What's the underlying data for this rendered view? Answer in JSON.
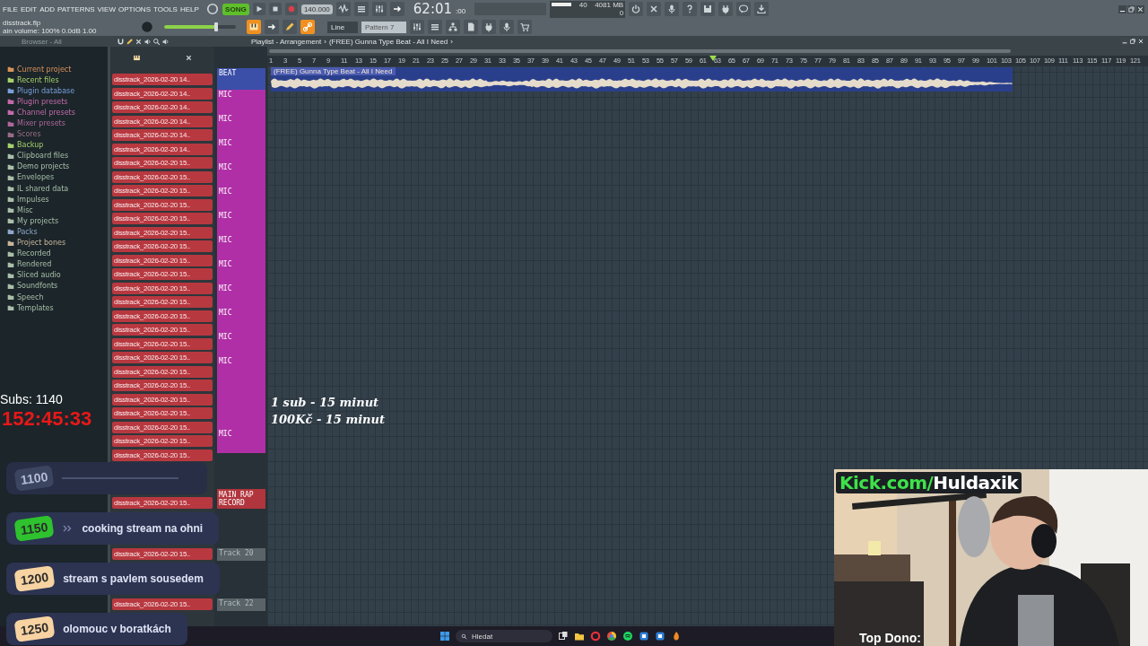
{
  "menu": [
    "FILE",
    "EDIT",
    "ADD",
    "PATTERNS",
    "VIEW",
    "OPTIONS",
    "TOOLS",
    "HELP"
  ],
  "transport": {
    "song_mode": {
      "label": "SONG",
      "on": true
    },
    "tempo": "140.000",
    "time": "62:01",
    "time_sub": ":00",
    "cpu": "40",
    "memory": "4081 MB",
    "polyphony": "0"
  },
  "project": {
    "file": "disstrack.flp",
    "hint": "ain volume: 100% 0.0dB 1.00",
    "master_volume": {
      "level": 0.72
    },
    "snap": "Line",
    "pattern": "Pattern 7"
  },
  "browser": {
    "title": "Browser - All",
    "items": [
      {
        "label": "Current project",
        "color": "#d9925a"
      },
      {
        "label": "Recent files",
        "color": "#a6d06a"
      },
      {
        "label": "Plugin database",
        "color": "#7a9fd8"
      },
      {
        "label": "Plugin presets",
        "color": "#c26aa8"
      },
      {
        "label": "Channel presets",
        "color": "#c26aa8"
      },
      {
        "label": "Mixer presets",
        "color": "#b0669a"
      },
      {
        "label": "Scores",
        "color": "#9a6c88"
      },
      {
        "label": "Backup",
        "color": "#a6d06a"
      },
      {
        "label": "Clipboard files",
        "color": "#a9bfa8"
      },
      {
        "label": "Demo projects",
        "color": "#a9bfa8"
      },
      {
        "label": "Envelopes",
        "color": "#a9bfa8"
      },
      {
        "label": "IL shared data",
        "color": "#a9bfa8"
      },
      {
        "label": "Impulses",
        "color": "#a9bfa8"
      },
      {
        "label": "Misc",
        "color": "#a9bfa8"
      },
      {
        "label": "My projects",
        "color": "#a9bfa8"
      },
      {
        "label": "Packs",
        "color": "#8fa6c8"
      },
      {
        "label": "Project bones",
        "color": "#c8b49a"
      },
      {
        "label": "Recorded",
        "color": "#a9bfa8"
      },
      {
        "label": "Rendered",
        "color": "#a9bfa8"
      },
      {
        "label": "Sliced audio",
        "color": "#a9bfa8"
      },
      {
        "label": "Soundfonts",
        "color": "#a9bfa8"
      },
      {
        "label": "Speech",
        "color": "#a9bfa8"
      },
      {
        "label": "Templates",
        "color": "#a9bfa8"
      }
    ]
  },
  "playlist": {
    "title": "Playlist - Arrangement",
    "separator": "›",
    "song": "(FREE) Gunna Type Beat - All I Need",
    "separator_end": "›",
    "ruler": [
      "1",
      "3",
      "5",
      "7",
      "9",
      "11",
      "13",
      "15",
      "17",
      "19",
      "21",
      "23",
      "25",
      "27",
      "29",
      "31",
      "33",
      "35",
      "37",
      "39",
      "41",
      "43",
      "45",
      "47",
      "49",
      "51",
      "53",
      "55",
      "57",
      "59",
      "61",
      "63",
      "65",
      "67",
      "69",
      "71",
      "73",
      "75",
      "77",
      "79",
      "81",
      "83",
      "85",
      "87",
      "89",
      "91",
      "93",
      "95",
      "97",
      "99",
      "101",
      "103",
      "105",
      "107",
      "109",
      "111",
      "113",
      "115",
      "117",
      "119",
      "121"
    ],
    "audio_clip": {
      "label": "(FREE) Gunna Type Beat - All I Need"
    },
    "clips": [
      "disstrack_2026-02-20 14..",
      "disstrack_2026-02-20 14..",
      "disstrack_2026-02-20 14..",
      "disstrack_2026-02-20 14..",
      "disstrack_2026-02-20 14..",
      "disstrack_2026-02-20 14..",
      "disstrack_2026-02-20 15..",
      "disstrack_2026-02-20 15..",
      "disstrack_2026-02-20 15..",
      "disstrack_2026-02-20 15..",
      "disstrack_2026-02-20 15..",
      "disstrack_2026-02-20 15..",
      "disstrack_2026-02-20 15..",
      "disstrack_2026-02-20 15..",
      "disstrack_2026-02-20 15..",
      "disstrack_2026-02-20 15..",
      "disstrack_2026-02-20 15..",
      "disstrack_2026-02-20 15..",
      "disstrack_2026-02-20 15..",
      "disstrack_2026-02-20 15..",
      "disstrack_2026-02-20 15..",
      "disstrack_2026-02-20 15..",
      "disstrack_2026-02-20 15..",
      "disstrack_2026-02-20 15..",
      "disstrack_2026-02-20 15..",
      "disstrack_2026-02-20 15..",
      "disstrack_2026-02-20 15..",
      "disstrack_2026-02-20 15.."
    ],
    "lower_clips": [
      "disstrack_2026-02-20 15..",
      "disstrack_2026-02-20 15..",
      "disstrack_2026-02-20 15.."
    ],
    "tracks": [
      {
        "kind": "beat",
        "label": "BEAT"
      },
      {
        "kind": "mic",
        "label": "MIC"
      },
      {
        "kind": "mic",
        "label": "MIC"
      },
      {
        "kind": "mic",
        "label": "MIC"
      },
      {
        "kind": "mic",
        "label": "MIC"
      },
      {
        "kind": "mic",
        "label": "MIC"
      },
      {
        "kind": "mic",
        "label": "MIC"
      },
      {
        "kind": "mic",
        "label": "MIC"
      },
      {
        "kind": "mic",
        "label": "MIC"
      },
      {
        "kind": "mic",
        "label": "MIC"
      },
      {
        "kind": "mic",
        "label": "MIC"
      },
      {
        "kind": "mic",
        "label": "MIC"
      },
      {
        "kind": "mic",
        "label": "MIC"
      },
      {
        "kind": "mic"
      },
      {
        "kind": "mic"
      },
      {
        "kind": "mic",
        "label": "MIC"
      }
    ],
    "lower_tracks": [
      {
        "kind": "record",
        "label": "MAIN RAP RECORD"
      },
      {
        "kind": "empty",
        "label": "Track 20"
      },
      {
        "kind": "empty",
        "label": "Track 22"
      }
    ]
  },
  "overlay": {
    "subs": "Subs: 1140",
    "timer": "152:45:33",
    "rules": [
      "1 sub - 15 minut",
      "100Kč - 15 minut"
    ],
    "goals": [
      {
        "amount": "1100",
        "kind": "done",
        "color": "#3c4560"
      },
      {
        "amount": "1150",
        "kind": "current",
        "color": "#2ec22e",
        "text": "cooking stream na ohni"
      },
      {
        "amount": "1200",
        "kind": "upcoming",
        "color": "#f7d3a2",
        "text": "stream s pavlem sousedem"
      },
      {
        "amount": "1250",
        "kind": "upcoming",
        "color": "#f7d3a2",
        "text": "olomouc v boratkách"
      }
    ]
  },
  "webcam": {
    "kind": "picture",
    "channel_prefix": "Kick.com/",
    "channel_name": "Huldaxik",
    "label": "Top Dono:"
  },
  "taskbar": {
    "search": {
      "placeholder": "Hledat"
    }
  }
}
